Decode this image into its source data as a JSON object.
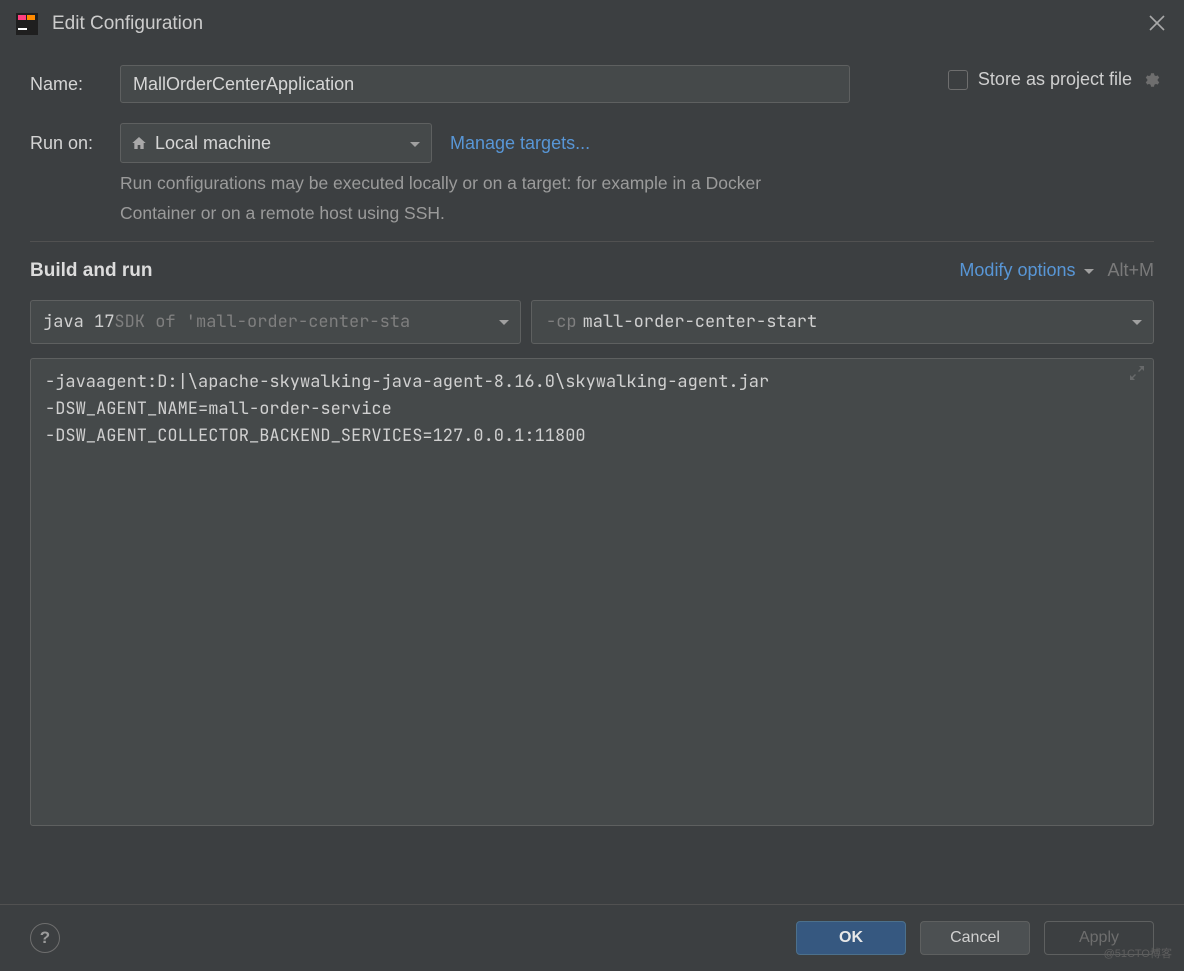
{
  "window": {
    "title": "Edit Configuration"
  },
  "form": {
    "name_label": "Name:",
    "name_value": "MallOrderCenterApplication",
    "store_label": "Store as project file",
    "runon_label": "Run on:",
    "runon_value": "Local machine",
    "manage_targets": "Manage targets...",
    "help_text": "Run configurations may be executed locally or on a target: for example in a Docker Container or on a remote host using SSH."
  },
  "build": {
    "section_title": "Build and run",
    "modify_label": "Modify options",
    "modify_shortcut": "Alt+M",
    "sdk_prefix": "java 17",
    "sdk_suffix": " SDK of 'mall-order-center-sta",
    "cp_prefix": "-cp",
    "cp_value": "mall-order-center-start",
    "vm_options": "-javaagent:D:|\\apache-skywalking-java-agent-8.16.0\\skywalking-agent.jar\n-DSW_AGENT_NAME=mall-order-service\n-DSW_AGENT_COLLECTOR_BACKEND_SERVICES=127.0.0.1:11800"
  },
  "footer": {
    "help": "?",
    "ok": "OK",
    "cancel": "Cancel",
    "apply": "Apply"
  },
  "watermark": "@51CTO博客"
}
